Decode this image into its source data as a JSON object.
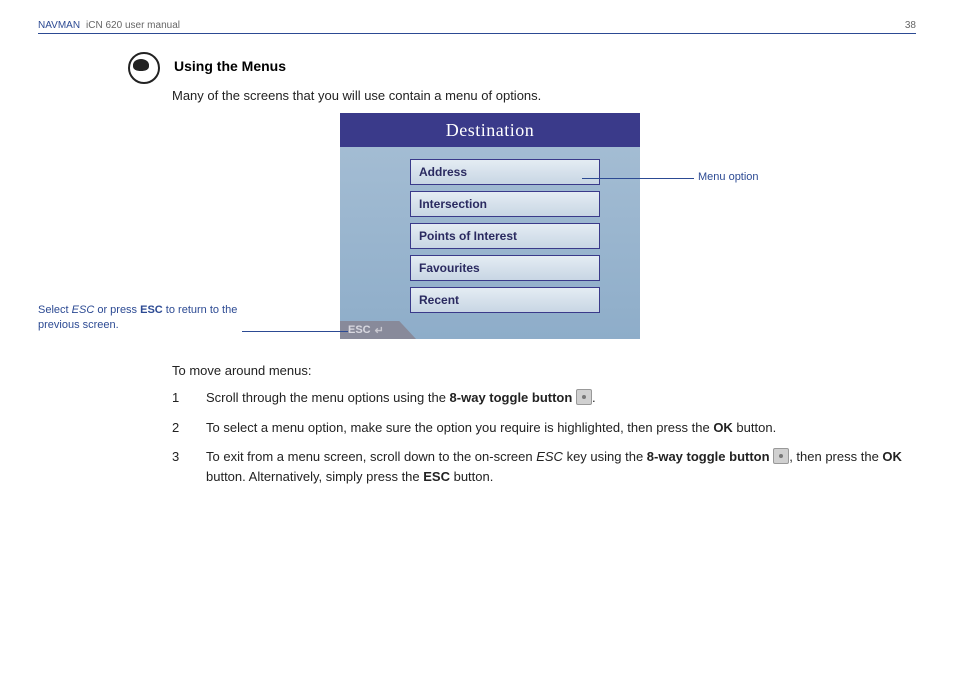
{
  "header": {
    "brand": "NAVMAN",
    "doc_title": "iCN 620 user manual",
    "page_num": "38"
  },
  "section": {
    "title": "Using the Menus",
    "intro": "Many of the screens that you will use contain a menu of options."
  },
  "device": {
    "title": "Destination",
    "menu": [
      "Address",
      "Intersection",
      "Points of Interest",
      "Favourites",
      "Recent"
    ],
    "esc": "ESC"
  },
  "callouts": {
    "menu_option": "Menu option",
    "esc_note_1": "Select ",
    "esc_note_2": "ESC",
    "esc_note_3": " or press ",
    "esc_note_4": "ESC",
    "esc_note_5": " to return to the previous screen."
  },
  "body": {
    "intro2": "To move around menus:"
  },
  "steps": [
    {
      "num": "1",
      "t1": "Scroll through the menu options using the ",
      "b1": "8-way toggle button",
      "t2": " ",
      "t3": "."
    },
    {
      "num": "2",
      "t1": "To select a menu option, make sure the option you require is highlighted, then press the ",
      "b1": "OK",
      "t2": " button."
    },
    {
      "num": "3",
      "t1": "To exit from a menu screen, scroll down to the on-screen ",
      "e1": "ESC",
      "t2": " key using the ",
      "b1": "8-way toggle button",
      "t3": " ",
      "t4": ", then press the ",
      "b2": "OK",
      "t5": " button. Alternatively, simply press the ",
      "b3": "ESC",
      "t6": " button."
    }
  ]
}
